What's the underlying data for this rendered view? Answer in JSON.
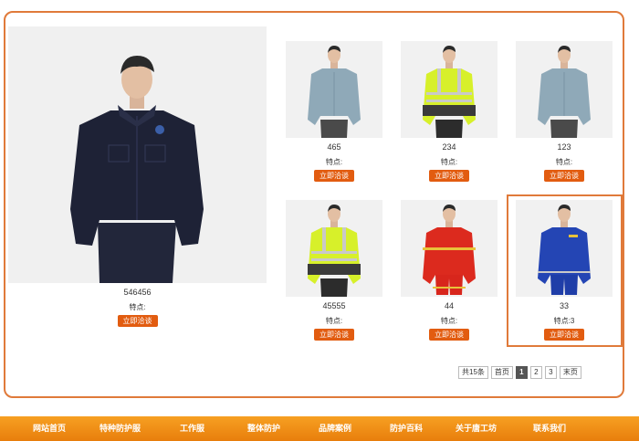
{
  "featured": {
    "name": "546456",
    "feature": "特点:",
    "button": "立即洽谈"
  },
  "products": [
    {
      "name": "465",
      "feature": "特点:",
      "button": "立即洽谈",
      "style": "shirt-blue"
    },
    {
      "name": "234",
      "feature": "特点:",
      "button": "立即洽谈",
      "style": "hivis"
    },
    {
      "name": "123",
      "feature": "特点:",
      "button": "立即洽谈",
      "style": "shirt-blue"
    },
    {
      "name": "45555",
      "feature": "特点:",
      "button": "立即洽谈",
      "style": "hivis"
    },
    {
      "name": "44",
      "feature": "特点:",
      "button": "立即洽谈",
      "style": "red"
    },
    {
      "name": "33",
      "feature": "特点:3",
      "button": "立即洽谈",
      "style": "royal"
    }
  ],
  "pagination": {
    "total": "共15条",
    "first": "首页",
    "pages": [
      "1",
      "2",
      "3"
    ],
    "current": "1",
    "last": "末页"
  },
  "nav": [
    "网站首页",
    "特种防护服",
    "工作服",
    "整体防护",
    "品牌案例",
    "防护百科",
    "关于唐工坊",
    "联系我们"
  ],
  "colors": {
    "accent": "#e07a3a",
    "button": "#e25c10",
    "nav": "#f39019"
  }
}
